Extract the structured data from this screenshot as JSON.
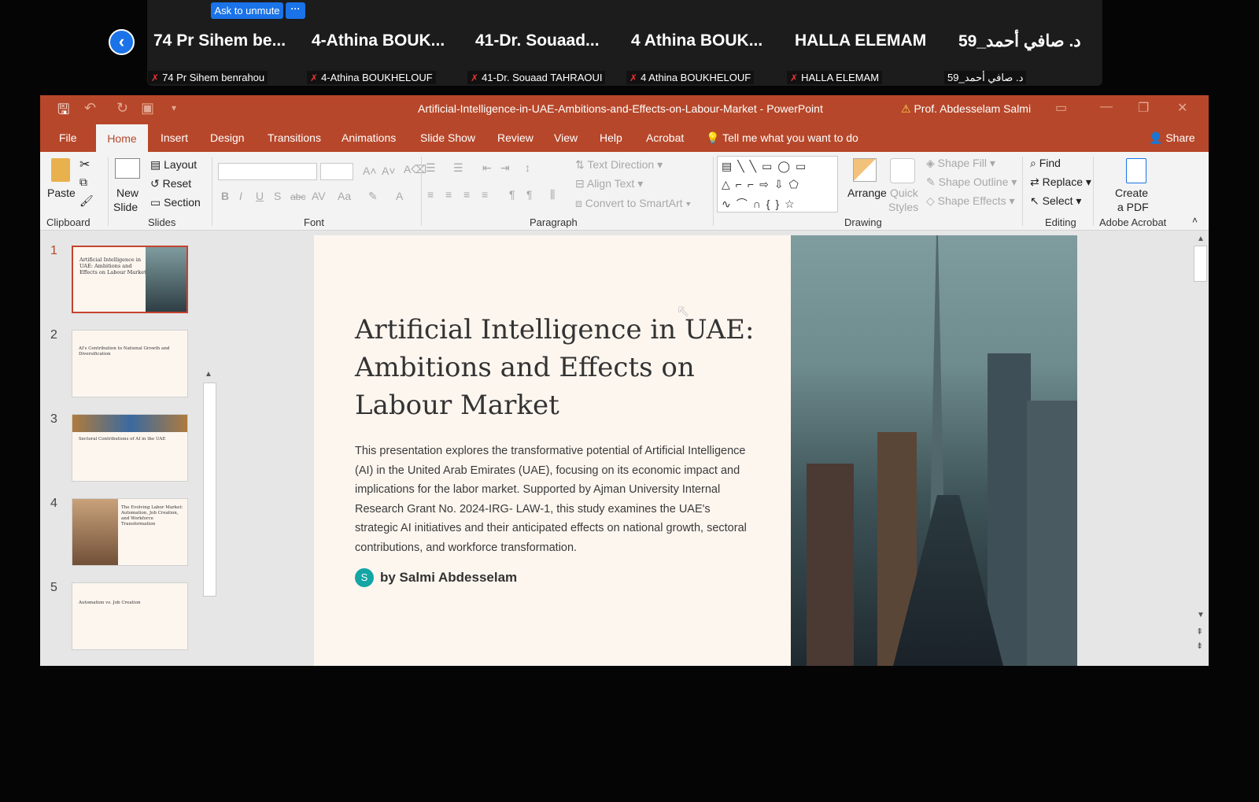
{
  "zoom": {
    "unmute_label": "Ask to unmute",
    "more_label": "···",
    "back_label": "‹",
    "participants": [
      {
        "name": "74 Pr Sihem be...",
        "label": "74 Pr Sihem benrahou"
      },
      {
        "name": "4-Athina BOUK...",
        "label": "4-Athina BOUKHELOUF"
      },
      {
        "name": "41-Dr. Souaad...",
        "label": "41-Dr. Souaad TAHRAOUI"
      },
      {
        "name": "4 Athina BOUK...",
        "label": "4 Athina BOUKHELOUF"
      },
      {
        "name": "HALLA ELEMAM",
        "label": "HALLA ELEMAM"
      },
      {
        "name": "د. صافي أحمد_59",
        "label": "د. صافي أحمد_59"
      }
    ]
  },
  "ppt": {
    "doc_title": "Artificial-Intelligence-in-UAE-Ambitions-and-Effects-on-Labour-Market  -  PowerPoint",
    "user": "Prof. Abdesselam Salmi",
    "tabs": [
      "File",
      "Home",
      "Insert",
      "Design",
      "Transitions",
      "Animations",
      "Slide Show",
      "Review",
      "View",
      "Help",
      "Acrobat"
    ],
    "tell_me": "Tell me what you want to do",
    "share": "Share",
    "ribbon": {
      "paste": "Paste",
      "new_slide_1": "New",
      "new_slide_2": "Slide",
      "layout": "Layout",
      "reset": "Reset",
      "section": "Section",
      "text_direction": "Text Direction",
      "align_text": "Align Text",
      "convert_smartart": "Convert to SmartArt",
      "arrange": "Arrange",
      "quick_styles_1": "Quick",
      "quick_styles_2": "Styles",
      "shape_fill": "Shape Fill",
      "shape_outline": "Shape Outline",
      "shape_effects": "Shape Effects",
      "find": "Find",
      "replace": "Replace",
      "select": "Select",
      "create_pdf_1": "Create",
      "create_pdf_2": "a PDF",
      "groups": [
        "Clipboard",
        "Slides",
        "Font",
        "Paragraph",
        "Drawing",
        "Editing",
        "Adobe Acrobat"
      ]
    },
    "slides": [
      {
        "num": "1",
        "title": "Artificial Intelligence in UAE: Ambitions and Effects on Labour Market"
      },
      {
        "num": "2",
        "title": "AI's Contribution to National Growth and Diversification"
      },
      {
        "num": "3",
        "title": "Sectoral Contributions of AI in the UAE"
      },
      {
        "num": "4",
        "title": "The Evolving Labor Market: Automation, Job Creation, and Workforce Transformation"
      },
      {
        "num": "5",
        "title": "Automation vs. Job Creation"
      }
    ],
    "slide": {
      "title": "Artificial Intelligence in UAE: Ambitions and Effects on Labour Market",
      "body": "This presentation explores the transformative potential of Artificial Intelligence (AI) in the United Arab Emirates (UAE), focusing on its economic impact and implications for the labor market. Supported by Ajman University Internal Research Grant No. 2024-IRG- LAW-1, this study examines the UAE's strategic AI initiatives and their anticipated effects on national growth, sectoral contributions, and workforce transformation.",
      "author_initial": "S",
      "author": "by Salmi Abdesselam"
    }
  }
}
